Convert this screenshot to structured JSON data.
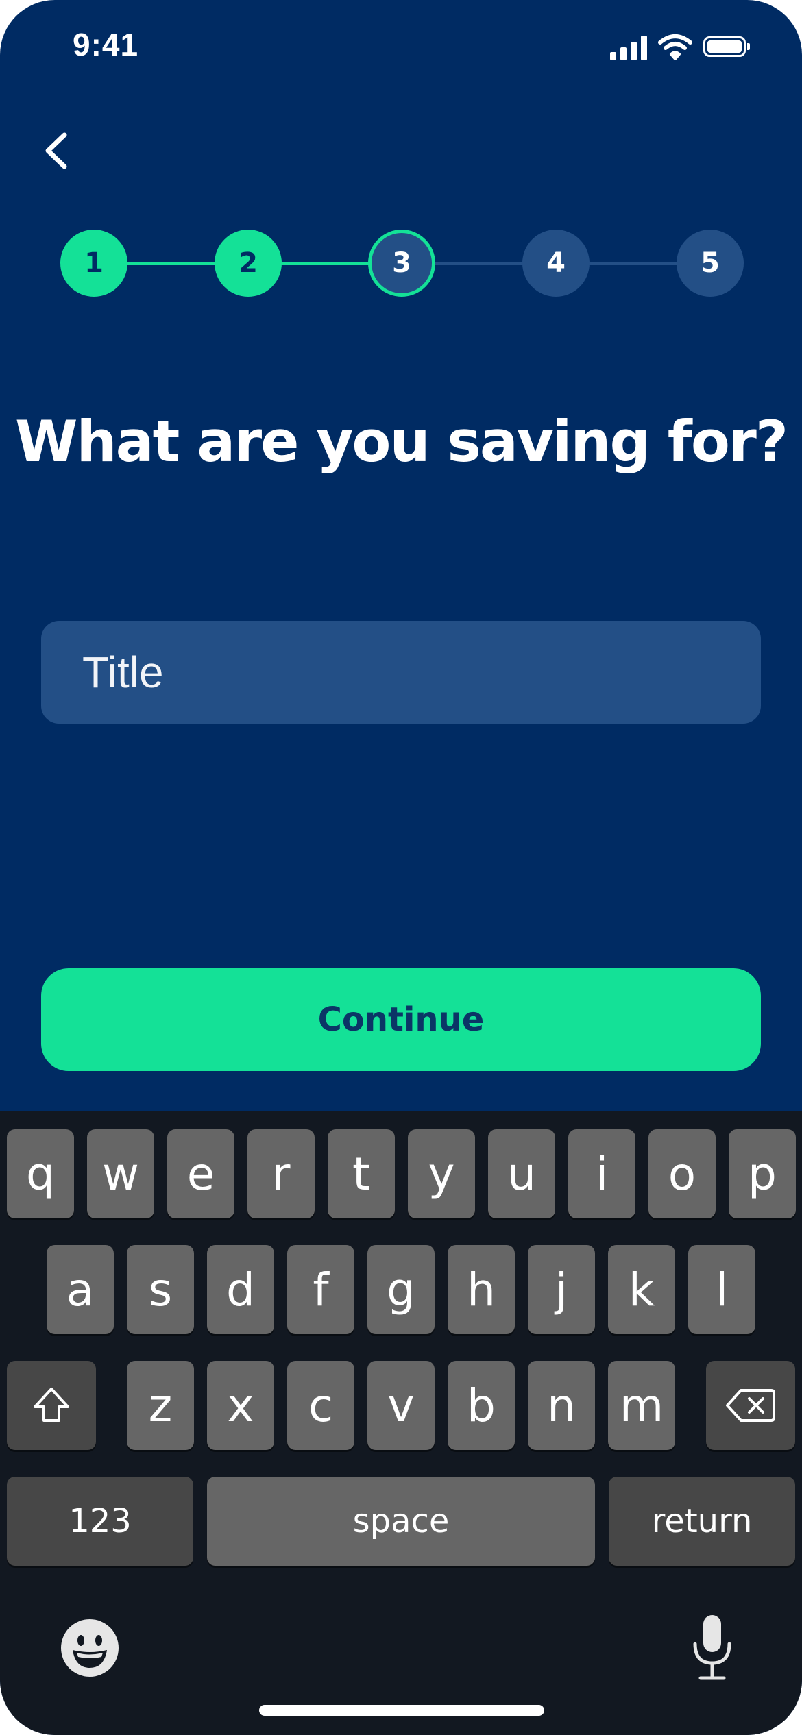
{
  "status_bar": {
    "time": "9:41",
    "icons": [
      "signal-icon",
      "wifi-icon",
      "battery-icon"
    ]
  },
  "nav": {
    "back_icon": "chevron-left-icon"
  },
  "stepper": {
    "current": 3,
    "steps": [
      {
        "label": "1",
        "state": "done"
      },
      {
        "label": "2",
        "state": "done"
      },
      {
        "label": "3",
        "state": "current"
      },
      {
        "label": "4",
        "state": "todo"
      },
      {
        "label": "5",
        "state": "todo"
      }
    ]
  },
  "headline": "What are you saving for?",
  "form": {
    "title_value": "",
    "title_placeholder": "Title"
  },
  "continue_label": "Continue",
  "keyboard": {
    "row1": [
      "q",
      "w",
      "e",
      "r",
      "t",
      "y",
      "u",
      "i",
      "o",
      "p"
    ],
    "row2": [
      "a",
      "s",
      "d",
      "f",
      "g",
      "h",
      "j",
      "k",
      "l"
    ],
    "row3": [
      "z",
      "x",
      "c",
      "v",
      "b",
      "n",
      "m"
    ],
    "shift_icon": "shift-icon",
    "delete_icon": "backspace-icon",
    "numbers_label": "123",
    "space_label": "space",
    "return_label": "return",
    "emoji_icon": "emoji-icon",
    "mic_icon": "microphone-icon"
  },
  "colors": {
    "background": "#002b63",
    "accent": "#14e197",
    "field": "#234f86",
    "keyboard_bg": "#121821",
    "key": "#666666",
    "key_dark": "#474747"
  }
}
